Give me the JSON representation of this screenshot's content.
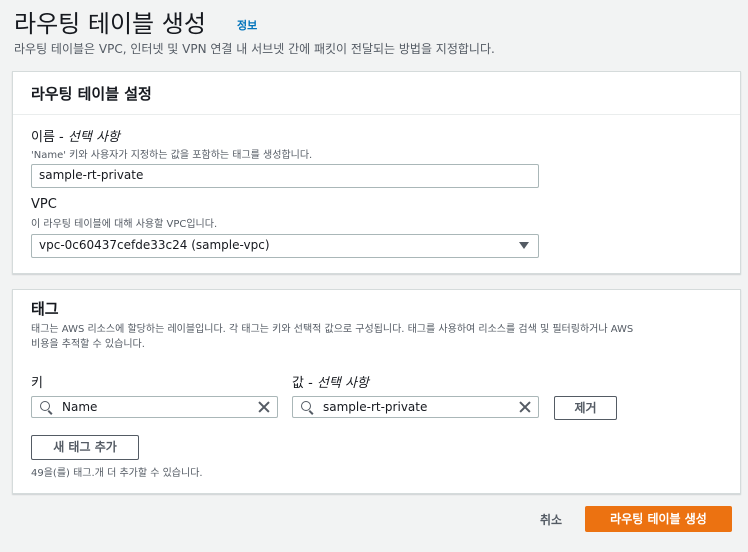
{
  "header": {
    "title": "라우팅 테이블 생성",
    "info_link": "정보",
    "description": "라우팅 테이블은 VPC, 인터넷 및 VPN 연결 내 서브넷 간에 패킷이 전달되는 방법을 지정합니다."
  },
  "settings": {
    "title": "라우팅 테이블 설정",
    "name_label": "이름 - ",
    "name_optional": "선택 사항",
    "name_desc": "'Name' 키와 사용자가 지정하는 값을 포함하는 태그를 생성합니다.",
    "name_value": "sample-rt-private",
    "vpc_label": "VPC",
    "vpc_desc": "이 라우팅 테이블에 대해 사용할 VPC입니다.",
    "vpc_value": "vpc-0c60437cefde33c24 (sample-vpc)"
  },
  "tags": {
    "title": "태그",
    "desc_line1": "태그는 AWS 리소스에 할당하는 레이블입니다. 각 태그는 키와 선택적 값으로 구성됩니다. 태그를 사용하여 리소스를 검색 및 필터링하거나 AWS",
    "desc_line2": "비용을 추적할 수 있습니다.",
    "key_label": "키",
    "value_label": "값 - ",
    "value_optional": "선택 사항",
    "key_value": "Name",
    "value_value": "sample-rt-private",
    "remove_button": "제거",
    "add_button": "새 태그 추가",
    "remaining_text": "49을(를) 태그.개 더 추가할 수 있습니다."
  },
  "footer": {
    "cancel": "취소",
    "create": "라우팅 테이블 생성"
  },
  "colors": {
    "primary": "#ec7211",
    "link": "#0073bb",
    "background": "#f2f3f3"
  },
  "icons": [
    "search-icon",
    "clear-icon",
    "caret-down-icon"
  ]
}
